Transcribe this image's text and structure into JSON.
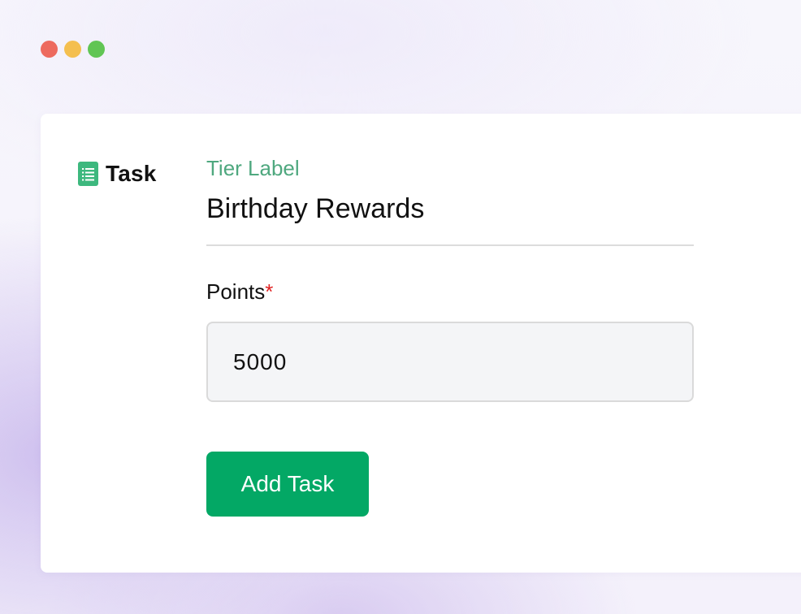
{
  "window": {
    "controls": [
      "close",
      "minimize",
      "maximize"
    ]
  },
  "colors": {
    "accent": "#03a865",
    "label_green": "#4fa87f",
    "required": "#e02020"
  },
  "task_header": {
    "icon": "document-list-icon",
    "title": "Task"
  },
  "tier": {
    "label": "Tier Label",
    "value": "Birthday Rewards"
  },
  "points": {
    "label": "Points",
    "required_mark": "*",
    "value": "5000"
  },
  "actions": {
    "add_task_label": "Add Task"
  }
}
